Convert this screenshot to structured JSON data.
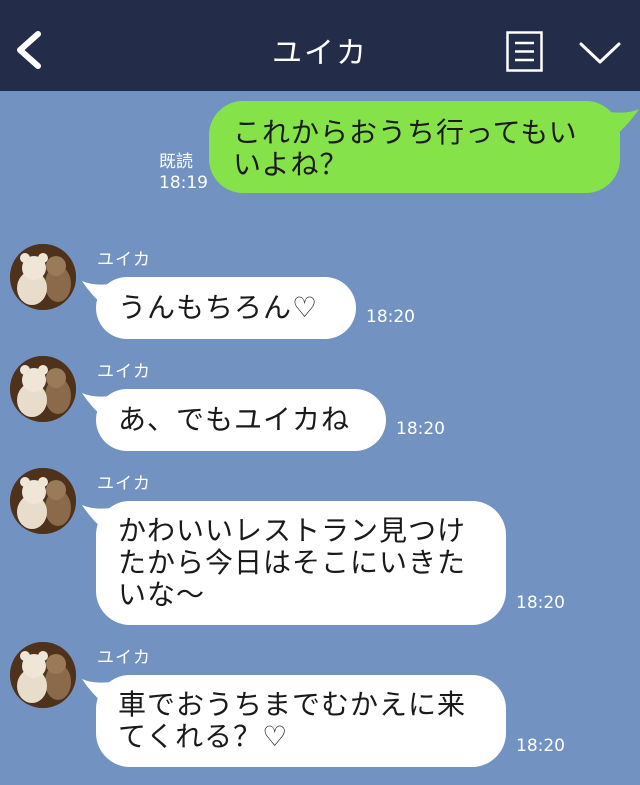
{
  "header": {
    "title": "ユイカ",
    "back_icon": "chevron-left-icon",
    "menu_icon": "menu-icon",
    "collapse_icon": "chevron-down-icon"
  },
  "colors": {
    "header_bg": "#232d49",
    "chat_bg": "#7292c2",
    "sent_bubble": "#85e249",
    "received_bubble": "#ffffff"
  },
  "messages": [
    {
      "direction": "sent",
      "lines": [
        "これからおうち行ってもい",
        "いよね？"
      ],
      "read_label": "既読",
      "time": "18:19"
    },
    {
      "direction": "received",
      "sender": "ユイカ",
      "lines": [
        "うんもちろん♡"
      ],
      "time": "18:20"
    },
    {
      "direction": "received",
      "sender": "ユイカ",
      "lines": [
        "あ、でもユイカね"
      ],
      "time": "18:20"
    },
    {
      "direction": "received",
      "sender": "ユイカ",
      "lines": [
        "かわいいレストラン見つけ",
        "たから今日はそこにいきた",
        "いな〜"
      ],
      "time": "18:20"
    },
    {
      "direction": "received",
      "sender": "ユイカ",
      "lines": [
        "車でおうちまでむかえに来",
        "てくれる？♡"
      ],
      "time": "18:20"
    }
  ]
}
